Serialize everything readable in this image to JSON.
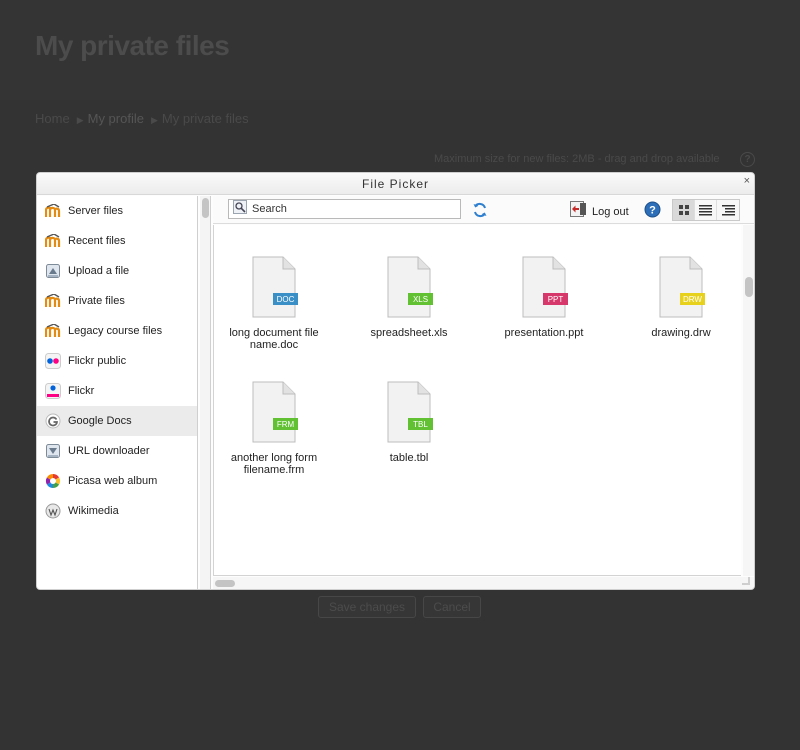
{
  "page": {
    "title": "My private files",
    "breadcrumb": [
      "Home",
      "My profile",
      "My private files"
    ],
    "max_size_note": "Maximum size for new files: 2MB - drag and drop available",
    "help_glyph": "?",
    "save_label": "Save changes",
    "cancel_label": "Cancel"
  },
  "dialog": {
    "title": "File Picker",
    "close_glyph": "×",
    "sidebar": [
      {
        "label": "Server files",
        "icon": "moodle-icon"
      },
      {
        "label": "Recent files",
        "icon": "moodle-icon"
      },
      {
        "label": "Upload a file",
        "icon": "upload-icon"
      },
      {
        "label": "Private files",
        "icon": "moodle-icon"
      },
      {
        "label": "Legacy course files",
        "icon": "moodle-icon"
      },
      {
        "label": "Flickr public",
        "icon": "flickr-icon"
      },
      {
        "label": "Flickr",
        "icon": "flickr-alt-icon"
      },
      {
        "label": "Google Docs",
        "icon": "google-icon"
      },
      {
        "label": "URL downloader",
        "icon": "download-icon"
      },
      {
        "label": "Picasa web album",
        "icon": "picasa-icon"
      },
      {
        "label": "Wikimedia",
        "icon": "wikimedia-icon"
      }
    ],
    "active_repository": "Google Docs",
    "toolbar": {
      "search_placeholder": "Search",
      "logout_label": "Log out"
    },
    "files": [
      {
        "name": "long document file name.doc",
        "name_line1": "long document file",
        "name_line2": "name.doc",
        "ext": "DOC",
        "badge_color": "#3a8fc7"
      },
      {
        "name": "spreadsheet.xls",
        "name_line1": "spreadsheet.xls",
        "name_line2": "",
        "ext": "XLS",
        "badge_color": "#62c133"
      },
      {
        "name": "presentation.ppt",
        "name_line1": "presentation.ppt",
        "name_line2": "",
        "ext": "PPT",
        "badge_color": "#d6386c"
      },
      {
        "name": "drawing.drw",
        "name_line1": "drawing.drw",
        "name_line2": "",
        "ext": "DRW",
        "badge_color": "#e8d11c"
      },
      {
        "name": "another long form filename.frm",
        "name_line1": "another long form",
        "name_line2": "filename.frm",
        "ext": "FRM",
        "badge_color": "#62c133"
      },
      {
        "name": "table.tbl",
        "name_line1": "table.tbl",
        "name_line2": "",
        "ext": "TBL",
        "badge_color": "#62c133"
      }
    ]
  }
}
